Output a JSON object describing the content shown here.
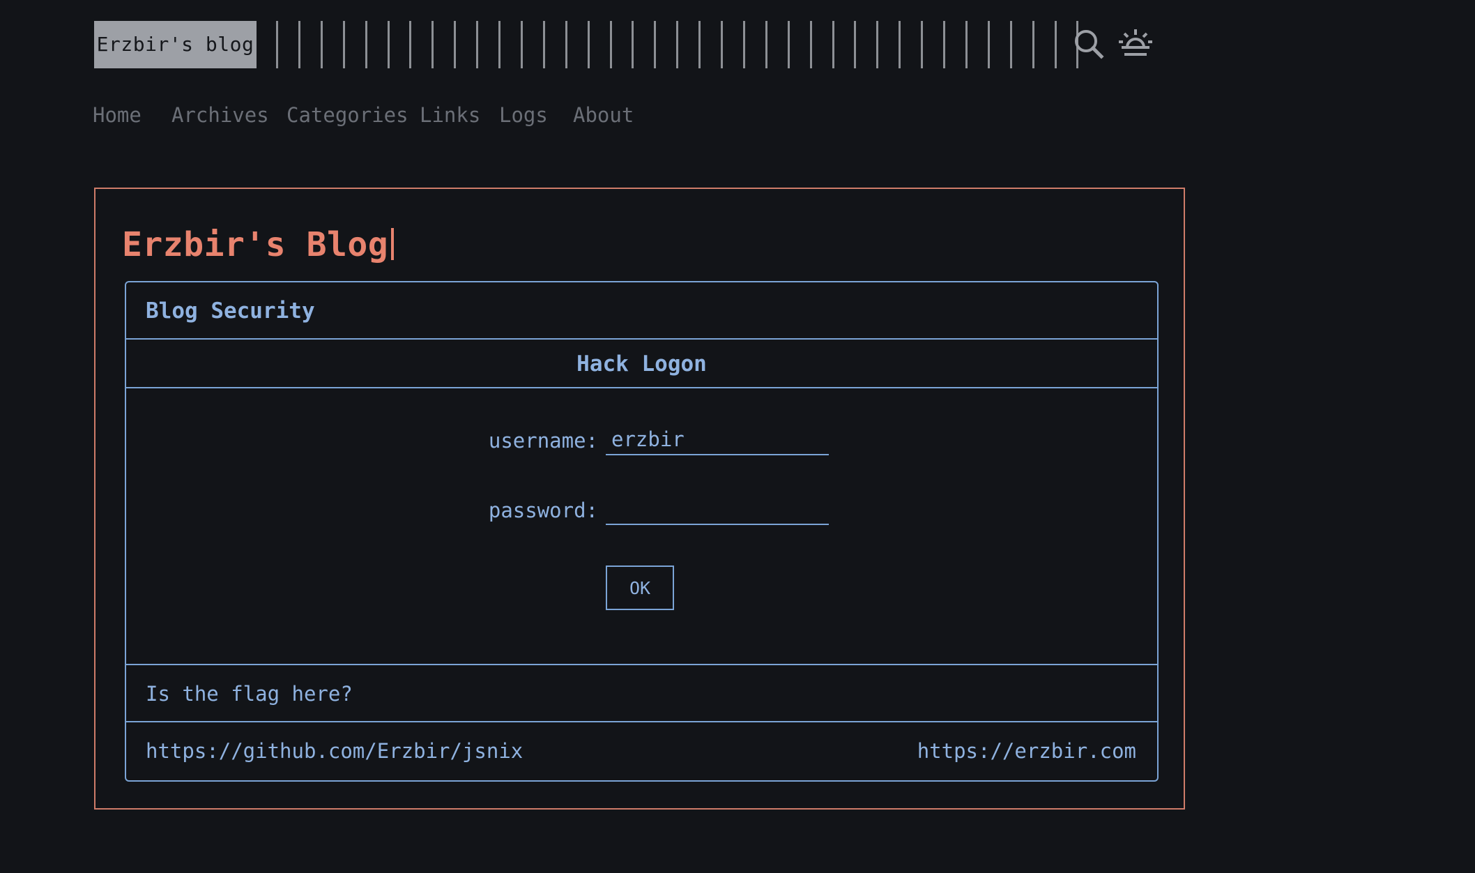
{
  "header": {
    "logo": "Erzbir's blog",
    "search_icon": "search-icon",
    "theme_icon": "theme-toggle-icon"
  },
  "nav": [
    "Home",
    "Archives",
    "Categories",
    "Links",
    "Logs",
    "About"
  ],
  "main": {
    "title": "Erzbir's Blog",
    "panel": {
      "title": "Blog Security",
      "form_title": "Hack Logon",
      "username_label": "username:",
      "username_value": "erzbir",
      "password_label": "password:",
      "password_value": "",
      "ok_label": "OK",
      "question": "Is the flag here?",
      "footer_left": "https://github.com/Erzbir/jsnix",
      "footer_right": "https://erzbir.com"
    }
  },
  "colors": {
    "background": "#121418",
    "accent": "#e8836e",
    "panel_blue": "#8fb2e0",
    "nav_gray": "#6b6f77"
  }
}
